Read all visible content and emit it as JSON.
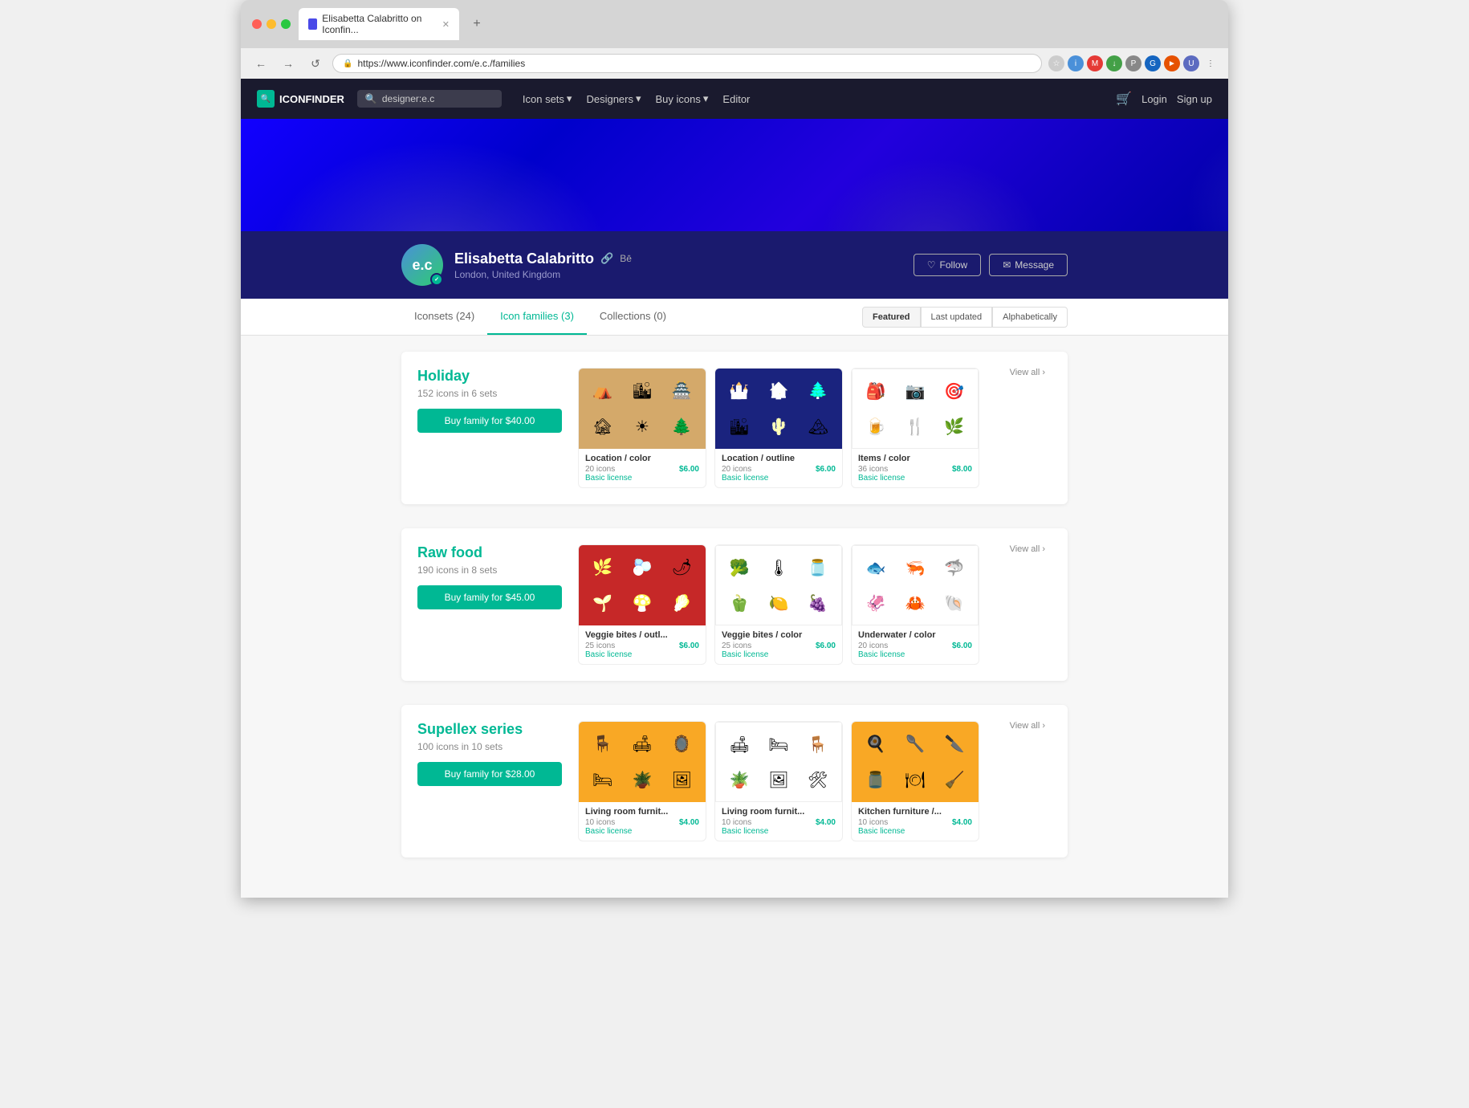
{
  "browser": {
    "tab_title": "Elisabetta Calabritto on Iconfin...",
    "url": "https://www.iconfinder.com/e.c./families",
    "new_tab": "+",
    "back": "←",
    "forward": "→",
    "refresh": "↺"
  },
  "header": {
    "logo_text": "ICONFINDER",
    "search_placeholder": "designer:e.c",
    "nav_items": [
      {
        "label": "Icon sets",
        "has_arrow": true
      },
      {
        "label": "Designers",
        "has_arrow": true
      },
      {
        "label": "Buy icons",
        "has_arrow": true
      },
      {
        "label": "Editor"
      }
    ],
    "cart_icon": "🛒",
    "login": "Login",
    "signup": "Sign up"
  },
  "profile": {
    "initials": "e.c",
    "name": "Elisabetta Calabritto",
    "location": "London, United Kingdom",
    "follow_label": "Follow",
    "message_label": "Message",
    "link_symbol": "🔗",
    "be_label": "Bē"
  },
  "tabs": [
    {
      "label": "Iconsets (24)",
      "active": false
    },
    {
      "label": "Icon families (3)",
      "active": true
    },
    {
      "label": "Collections (0)",
      "active": false
    }
  ],
  "sort": [
    {
      "label": "Featured",
      "active": true
    },
    {
      "label": "Last updated",
      "active": false
    },
    {
      "label": "Alphabetically",
      "active": false
    }
  ],
  "families": [
    {
      "name": "Holiday",
      "count": "152 icons in 6 sets",
      "buy_label": "Buy family for $40.00",
      "sets": [
        {
          "title": "Location / color",
          "icon_count": "20 icons",
          "price": "$6.00",
          "license": "Basic license",
          "bg_color": "#d4a96a",
          "icons": [
            "🏕",
            "🏙",
            "🏯",
            "🏚",
            "☀",
            "🌲"
          ]
        },
        {
          "title": "Location / outline",
          "icon_count": "20 icons",
          "price": "$6.00",
          "license": "Basic license",
          "bg_color": "#1a237e",
          "icons": [
            "🏰",
            "🏠",
            "🌲",
            "🏙",
            "🌵",
            "🏔"
          ]
        },
        {
          "title": "Items / color",
          "icon_count": "36 icons",
          "price": "$8.00",
          "license": "Basic license",
          "bg_color": "#ffffff",
          "icons": [
            "🎒",
            "📷",
            "🎯",
            "🍺",
            "🍴",
            "🌿"
          ]
        }
      ],
      "view_all": "View all ›"
    },
    {
      "name": "Raw food",
      "count": "190 icons in 8 sets",
      "buy_label": "Buy family for $45.00",
      "sets": [
        {
          "title": "Veggie bites / outl...",
          "icon_count": "25 icons",
          "price": "$6.00",
          "license": "Basic license",
          "bg_color": "#c62828",
          "icons": [
            "🌿",
            "🫐",
            "🌶",
            "🌱",
            "🍄",
            "🥬"
          ]
        },
        {
          "title": "Veggie bites / color",
          "icon_count": "25 icons",
          "price": "$6.00",
          "license": "Basic license",
          "bg_color": "#ffffff",
          "icons": [
            "🥦",
            "🌡",
            "🫙",
            "🫑",
            "🍋",
            "🍇"
          ]
        },
        {
          "title": "Underwater / color",
          "icon_count": "20 icons",
          "price": "$6.00",
          "license": "Basic license",
          "bg_color": "#ffffff",
          "icons": [
            "🐟",
            "🦐",
            "🦈",
            "🦑",
            "🦀",
            "🪸"
          ]
        }
      ],
      "view_all": "View all ›"
    },
    {
      "name": "Supellex series",
      "count": "100 icons in 10 sets",
      "buy_label": "Buy family for $28.00",
      "sets": [
        {
          "title": "Living room furnit...",
          "icon_count": "10 icons",
          "price": "$4.00",
          "license": "Basic license",
          "bg_color": "#f9a825",
          "icons": [
            "🪑",
            "🛋",
            "🪞",
            "🛏",
            "🪴",
            "🖼"
          ]
        },
        {
          "title": "Living room furnit...",
          "icon_count": "10 icons",
          "price": "$4.00",
          "license": "Basic license",
          "bg_color": "#ffffff",
          "icons": [
            "🛋",
            "🛏",
            "🪑",
            "🪴",
            "🖼",
            "🛠"
          ]
        },
        {
          "title": "Kitchen furniture /...",
          "icon_count": "10 icons",
          "price": "$4.00",
          "license": "Basic license",
          "bg_color": "#f9a825",
          "icons": [
            "🍳",
            "🥄",
            "🔪",
            "🫙",
            "🍽",
            "🧹"
          ]
        }
      ],
      "view_all": "View all ›"
    }
  ]
}
